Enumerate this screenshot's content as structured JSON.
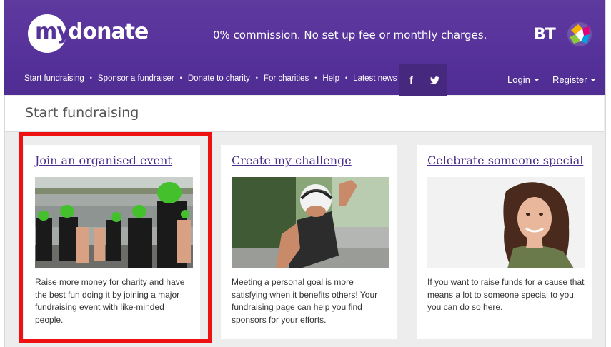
{
  "brand": {
    "logo_my": "my",
    "logo_donate": "donate",
    "tagline": "0% commission. No set up fee or monthly charges.",
    "partner": "BT"
  },
  "nav": {
    "links": [
      "Start fundraising",
      "Sponsor a fundraiser",
      "Donate to charity",
      "For charities",
      "Help",
      "Latest news"
    ],
    "separator": "•",
    "social": {
      "facebook": "f",
      "twitter": "t"
    },
    "login": "Login",
    "register": "Register"
  },
  "page": {
    "title": "Start fundraising"
  },
  "cards": [
    {
      "title": "Join an organised event",
      "text": "Raise more money for charity and have the best fun doing it by joining a major fundraising event with like-minded people.",
      "image": "open-water-swimmers-photo",
      "highlighted": true
    },
    {
      "title": "Create my challenge",
      "text": "Meeting a personal goal is more satisfying when it benefits others! Your fundraising page can help you find sponsors for your efforts.",
      "image": "cyclist-photo"
    },
    {
      "title": "Celebrate someone special",
      "text": "If you want to raise funds for a cause that means a lot to someone special to you, you can do so here.",
      "image": "smiling-woman-photo"
    }
  ],
  "colors": {
    "brand_purple": "#55319a",
    "link_purple": "#4a2e8c",
    "highlight_red": "#ee1111",
    "background": "#ededed"
  }
}
